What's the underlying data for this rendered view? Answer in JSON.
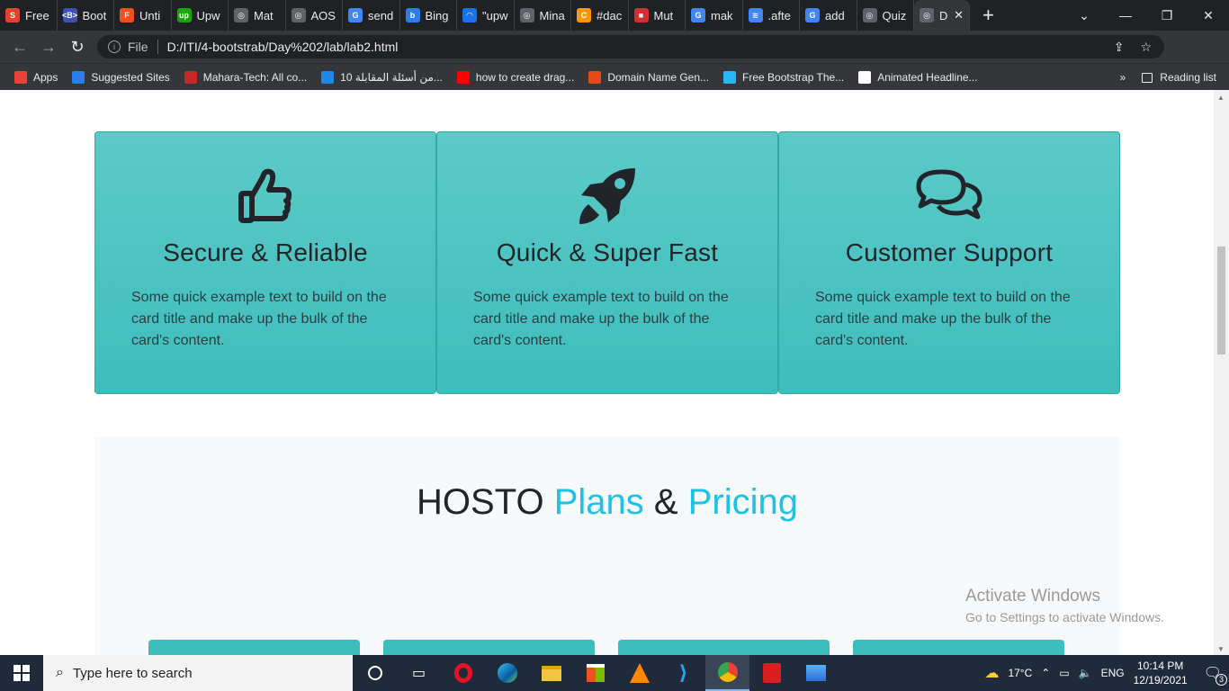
{
  "browser": {
    "tabs": [
      {
        "label": "Free",
        "color": "#e8402c",
        "glyph": "S"
      },
      {
        "label": "Boot",
        "color": "#3f51b5",
        "glyph": "<B>"
      },
      {
        "label": "Unti",
        "color": "#f24e1e",
        "glyph": "F"
      },
      {
        "label": "Upw",
        "color": "#14a800",
        "glyph": "up"
      },
      {
        "label": "Mat",
        "color": "#5f6368",
        "glyph": "◎"
      },
      {
        "label": "AOS",
        "color": "#5f6368",
        "glyph": "◎"
      },
      {
        "label": "send",
        "color": "#4285f4",
        "glyph": "G"
      },
      {
        "label": "Bing",
        "color": "#2b7de9",
        "glyph": "b"
      },
      {
        "label": "\"upw",
        "color": "#1a73e8",
        "glyph": "◠"
      },
      {
        "label": "Mina",
        "color": "#5f6368",
        "glyph": "◎"
      },
      {
        "label": "#dac",
        "color": "#ff9800",
        "glyph": "C"
      },
      {
        "label": "Mut",
        "color": "#d32f2f",
        "glyph": "■"
      },
      {
        "label": "mak",
        "color": "#4285f4",
        "glyph": "G"
      },
      {
        "label": ".afte",
        "color": "#4285f4",
        "glyph": "≋"
      },
      {
        "label": "add",
        "color": "#4285f4",
        "glyph": "G"
      },
      {
        "label": "Quiz",
        "color": "#5f6368",
        "glyph": "◎"
      },
      {
        "label": "D",
        "color": "#5f6368",
        "glyph": "◎",
        "active": true
      }
    ],
    "new_tab": "+",
    "url_prefix": "File",
    "url": "D:/ITI/4-bootstrab/Day%202/lab/lab2.html",
    "bookmarks": [
      {
        "label": "Apps",
        "color": "#ea4335"
      },
      {
        "label": "Suggested Sites",
        "color": "#2b7de9"
      },
      {
        "label": "Mahara-Tech: All co...",
        "color": "#c62828"
      },
      {
        "label": "10 من أسئلة المقابلة...",
        "color": "#1e88e5"
      },
      {
        "label": "how to create drag...",
        "color": "#ff0000"
      },
      {
        "label": "Domain Name Gen...",
        "color": "#e64a19"
      },
      {
        "label": "Free Bootstrap The...",
        "color": "#29b6f6"
      },
      {
        "label": "Animated Headline...",
        "color": "#ffffff"
      }
    ],
    "more": "»",
    "reading_list": "Reading list"
  },
  "features": [
    {
      "icon": "thumbs-up-icon",
      "title": "Secure & Reliable",
      "text": "Some quick example text to build on the card title and make up the bulk of the card's content."
    },
    {
      "icon": "rocket-icon",
      "title": "Quick & Super Fast",
      "text": "Some quick example text to build on the card title and make up the bulk of the card's content."
    },
    {
      "icon": "comments-icon",
      "title": "Customer Support",
      "text": "Some quick example text to build on the card title and make up the bulk of the card's content."
    }
  ],
  "plans": {
    "heading_part1": "HOSTO",
    "heading_accent1": "Plans",
    "heading_and": "&",
    "heading_accent2": "Pricing",
    "accent_color": "#1ec2e4",
    "card_color": "#3ebdbd"
  },
  "watermark": {
    "title": "Activate Windows",
    "subtitle": "Go to Settings to activate Windows."
  },
  "taskbar": {
    "search_placeholder": "Type here to search",
    "weather": "17°C",
    "language": "ENG",
    "time": "10:14 PM",
    "date": "12/19/2021",
    "notifications": "3"
  }
}
